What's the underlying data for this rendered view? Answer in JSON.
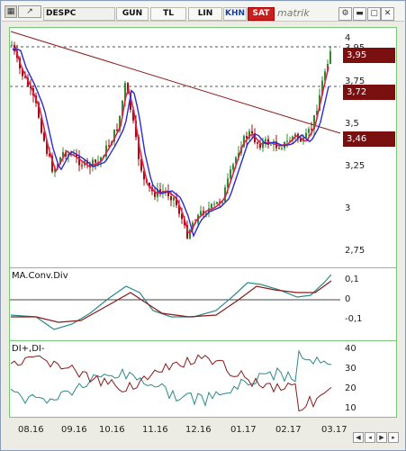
{
  "toolbar": {
    "symbol": "DESPC",
    "buttons": [
      "GUN",
      "TL",
      "LIN",
      "KHN",
      "SAT"
    ],
    "logo": "matrik"
  },
  "price_axis": {
    "ticks": [
      "4",
      "3,95",
      "3,75",
      "3,5",
      "3,25",
      "3",
      "2,75"
    ],
    "markers": [
      "3,95",
      "3,72",
      "3,46"
    ]
  },
  "macd_panel": {
    "title": "MA.Conv.Div",
    "ticks": [
      "0,1",
      "0",
      "-0,1"
    ]
  },
  "dmi_panel": {
    "title": "DI+,DI-",
    "ticks": [
      "40",
      "30",
      "20",
      "10"
    ]
  },
  "x_axis": {
    "labels": [
      "08.16",
      "09.16",
      "10.16",
      "11.16",
      "12.16",
      "01.17",
      "02.17",
      "03.17"
    ]
  },
  "colors": {
    "trendline": "#8b1a1a",
    "marker_box": "#7a0f0f",
    "candle_up": "#2e8b2e",
    "candle_down": "#a01010",
    "ma_fast": "#e0204a",
    "ma_slow": "#2a2ad0",
    "macd": "#2a8a8a",
    "signal": "#8b1a1a",
    "panel_border": "#79c779"
  }
}
